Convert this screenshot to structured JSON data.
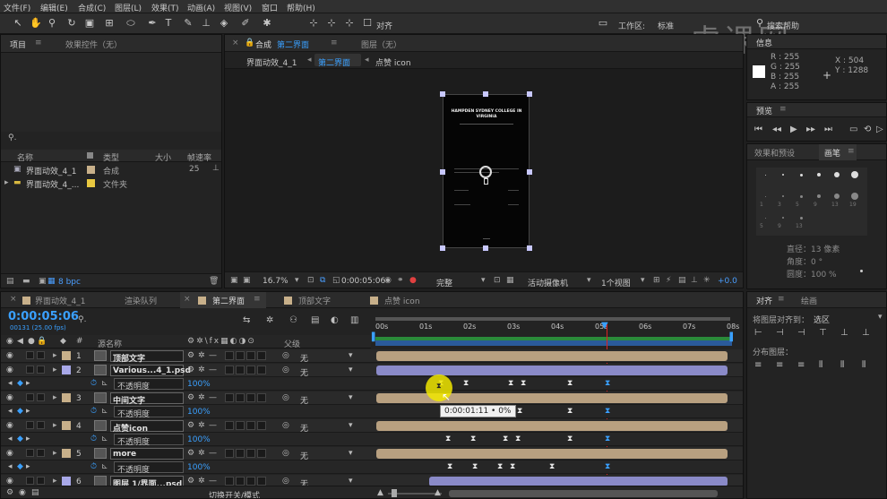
{
  "menu": [
    "文件(F)",
    "编辑(E)",
    "合成(C)",
    "图层(L)",
    "效果(T)",
    "动画(A)",
    "视图(V)",
    "窗口",
    "帮助(H)"
  ],
  "toolbar": {
    "align_label": "对齐",
    "workspace_label": "工作区:",
    "workspace_value": "标准",
    "search_placeholder": "搜索帮助"
  },
  "watermark": "虎课网",
  "project_panel": {
    "tab_project": "项目",
    "tab_effects": "效果控件（无）",
    "columns": {
      "name": "名称",
      "type": "类型",
      "size": "大小",
      "fps": "帧速率"
    },
    "items": [
      {
        "name": "界面动效_4_1",
        "type": "合成",
        "fps": "25",
        "color": "#c8b08a"
      },
      {
        "name": "界面动效_4_...",
        "type": "文件夹",
        "fps": "",
        "color": "#e8c840"
      }
    ],
    "bpc": "8 bpc"
  },
  "viewer": {
    "tab_comp_prefix": "合成",
    "tab_comp_name": "第二界面",
    "tab_layer": "图层（无）",
    "crumbs": [
      "界面动效_4_1",
      "第二界面",
      "点赞 icon"
    ],
    "phone_title": "HAMPDEN SYDNEY COLLEGE IN VIRGINIA",
    "zoom": "16.7%",
    "timecode": "0:00:05:06",
    "quality": "完整",
    "camera": "活动摄像机",
    "views": "1个视图",
    "exposure": "+0.0"
  },
  "info_panel": {
    "tab": "信息",
    "r": "R : 255",
    "g": "G : 255",
    "b": "B : 255",
    "a": "A : 255",
    "x": "X : 504",
    "y": "Y : 1288"
  },
  "preview_panel": {
    "tab": "预览"
  },
  "brush_panel": {
    "tab_effects": "效果和预设",
    "tab_brush": "画笔",
    "sizes": [
      "1",
      "3",
      "5",
      "9",
      "13",
      "19",
      "5",
      "9",
      "13",
      "17",
      "21",
      "27",
      "35",
      "45",
      "65"
    ],
    "diameter": "直径：13 像素",
    "angle": "角度：0 °",
    "roundness": "圆度：100 %"
  },
  "align_panel": {
    "tab_align": "对齐",
    "tab_paint": "绘画",
    "align_to_label": "将图层对齐到：",
    "align_to_value": "选区",
    "distribute_label": "分布图层："
  },
  "timeline": {
    "tabs": [
      "界面动效_4_1",
      "渲染队列",
      "第二界面",
      "顶部文字",
      "点赞 icon"
    ],
    "timecode": "0:00:05:06",
    "frame_info": "00131 (25.00 fps)",
    "col_source": "源名称",
    "col_parent": "父级",
    "ruler": [
      "00s",
      "01s",
      "02s",
      "03s",
      "04s",
      "05s",
      "06s",
      "07s",
      "08s"
    ],
    "footer_toggle": "切换开关/模式",
    "tooltip": "0:00:01:11 • 0%",
    "layers": [
      {
        "num": "1",
        "name": "顶部文字",
        "color": "#c8b08a",
        "parent": "无",
        "kind": "layer"
      },
      {
        "num": "2",
        "name": "Various...4_1.psd",
        "color": "#a8a8e8",
        "parent": "无",
        "kind": "layer"
      },
      {
        "num": "",
        "name": "不透明度",
        "value": "100%",
        "kind": "prop"
      },
      {
        "num": "3",
        "name": "中间文字",
        "color": "#c8b08a",
        "parent": "无",
        "kind": "layer"
      },
      {
        "num": "",
        "name": "不透明度",
        "value": "100%",
        "kind": "prop"
      },
      {
        "num": "4",
        "name": "点赞icon",
        "color": "#c8b08a",
        "parent": "无",
        "kind": "layer"
      },
      {
        "num": "",
        "name": "不透明度",
        "value": "100%",
        "kind": "prop"
      },
      {
        "num": "5",
        "name": "more",
        "color": "#c8b08a",
        "parent": "无",
        "kind": "layer"
      },
      {
        "num": "",
        "name": "不透明度",
        "value": "100%",
        "kind": "prop"
      },
      {
        "num": "6",
        "name": "图层 1/界面...psd",
        "color": "#a8a8e8",
        "parent": "无",
        "kind": "layer"
      }
    ]
  }
}
